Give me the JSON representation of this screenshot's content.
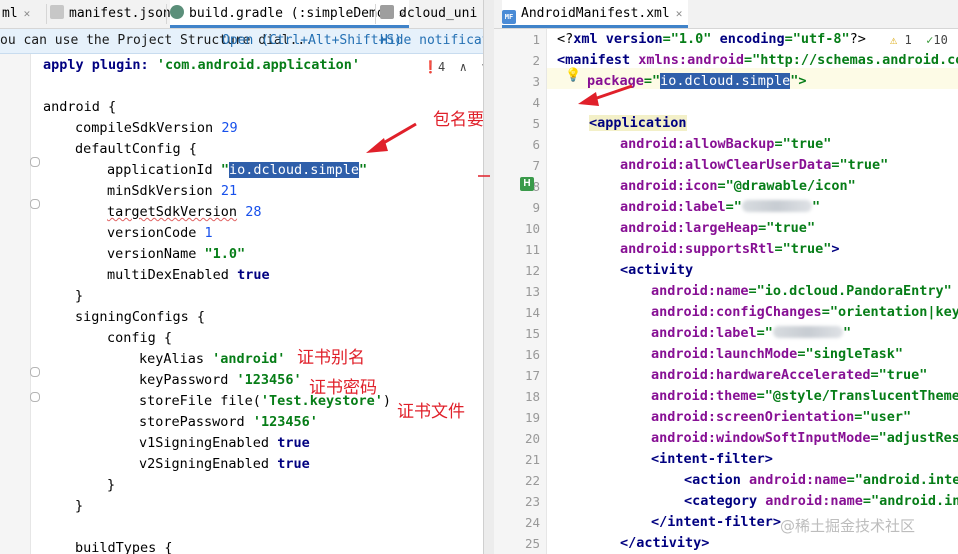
{
  "left_tabs": [
    {
      "label": "ml"
    },
    {
      "label": "manifest.json"
    },
    {
      "label": "build.gradle (:simpleDemo)"
    },
    {
      "label": "dcloud_uni"
    }
  ],
  "notification": {
    "message": "ou can use the Project Structure dial...",
    "open_link": "Open (Ctrl+Alt+Shift+S)",
    "hide_link": "Hide notification"
  },
  "left_inspection": {
    "warnings": "4"
  },
  "gradle": {
    "apply_kw": "apply plugin:",
    "apply_val": "'com.android.application'",
    "android": "android {",
    "compile_kw": "compileSdkVersion",
    "compile_val": "29",
    "default_config": "defaultConfig {",
    "app_id_kw": "applicationId",
    "app_id_val": "io.dcloud.simple",
    "min_kw": "minSdkVersion",
    "min_val": "21",
    "target_kw": "targetSdkVersion",
    "target_val": "28",
    "version_code_kw": "versionCode",
    "version_code_val": "1",
    "version_name_kw": "versionName",
    "version_name_val": "\"1.0\"",
    "multidex_kw": "multiDexEnabled",
    "multidex_val": "true",
    "close_brace": "}",
    "signing_configs": "signingConfigs {",
    "config": "config {",
    "key_alias_kw": "keyAlias",
    "key_alias_val": "'android'",
    "key_password_kw": "keyPassword",
    "key_password_val": "'123456'",
    "store_file_kw": "storeFile file(",
    "store_file_val": "'Test.keystore'",
    "store_file_end": ")",
    "store_password_kw": "storePassword",
    "store_password_val": "'123456'",
    "v1_kw": "v1SigningEnabled",
    "v1_val": "true",
    "v2_kw": "v2SigningEnabled",
    "v2_val": "true",
    "build_types": "buildTypes {"
  },
  "annotations": {
    "package_match": "包名要一致",
    "cert_alias": "证书别名",
    "cert_password": "证书密码",
    "cert_file": "证书文件"
  },
  "right_tab": {
    "badge": "MF",
    "label": "AndroidManifest.xml"
  },
  "right_inspection": {
    "warnings": "1",
    "ok": "10"
  },
  "line_numbers": [
    "1",
    "2",
    "3",
    "4",
    "5",
    "6",
    "7",
    "8",
    "9",
    "10",
    "11",
    "12",
    "13",
    "14",
    "15",
    "16",
    "17",
    "18",
    "19",
    "20",
    "21",
    "22",
    "23",
    "24",
    "25"
  ],
  "manifest": {
    "l1_a": "<?",
    "l1_b": "xml version",
    "l1_c": "=\"1.0\" ",
    "l1_d": "encoding",
    "l1_e": "=\"utf-8\"",
    "l1_f": "?>",
    "l2_tag": "<manifest",
    "l2_attr": "xmlns:android",
    "l2_val": "=\"http://schemas.android.co",
    "l3_attr": "package",
    "l3_eq": "=\"",
    "l3_val": "io.dcloud.simple",
    "l3_end": "\">",
    "l5_tag": "<application",
    "l6": "android:allowBackup",
    "l6v": "=\"true\"",
    "l7": "android:allowClearUserData",
    "l7v": "=\"true\"",
    "l8": "android:icon",
    "l8v": "=\"@drawable/icon\"",
    "l9": "android:label",
    "l9v": "=\"",
    "l9e": "\"",
    "l10": "android:largeHeap",
    "l10v": "=\"true\"",
    "l11": "android:supportsRtl",
    "l11v": "=\"true\"",
    "l11e": ">",
    "l12_tag": "<activity",
    "l13": "android:name",
    "l13v": "=\"io.dcloud.PandoraEntry\"",
    "l14": "android:configChanges",
    "l14v": "=\"orientation|key",
    "l15": "android:label",
    "l15v": "=\"",
    "l15e": "\"",
    "l16": "android:launchMode",
    "l16v": "=\"singleTask\"",
    "l17": "android:hardwareAccelerated",
    "l17v": "=\"true\"",
    "l18": "android:theme",
    "l18v": "=\"@style/TranslucentTheme",
    "l19": "android:screenOrientation",
    "l19v": "=\"user\"",
    "l20": "android:windowSoftInputMode",
    "l20v": "=\"adjustRes",
    "l21_tag": "<intent-filter>",
    "l22_tag": "<action",
    "l22_attr": "android:name",
    "l22_val": "=\"android.inte",
    "l23_tag": "<category",
    "l23_attr": "android:name",
    "l23_val": "=\"android.in",
    "l24_tag": "</intent-filter>",
    "l25_tag": "</activity>"
  },
  "watermark": "@稀土掘金技术社区",
  "colors": {
    "annotation": "#e0202a",
    "selection": "#2f5faa",
    "tab_underline": "#4083c9"
  }
}
